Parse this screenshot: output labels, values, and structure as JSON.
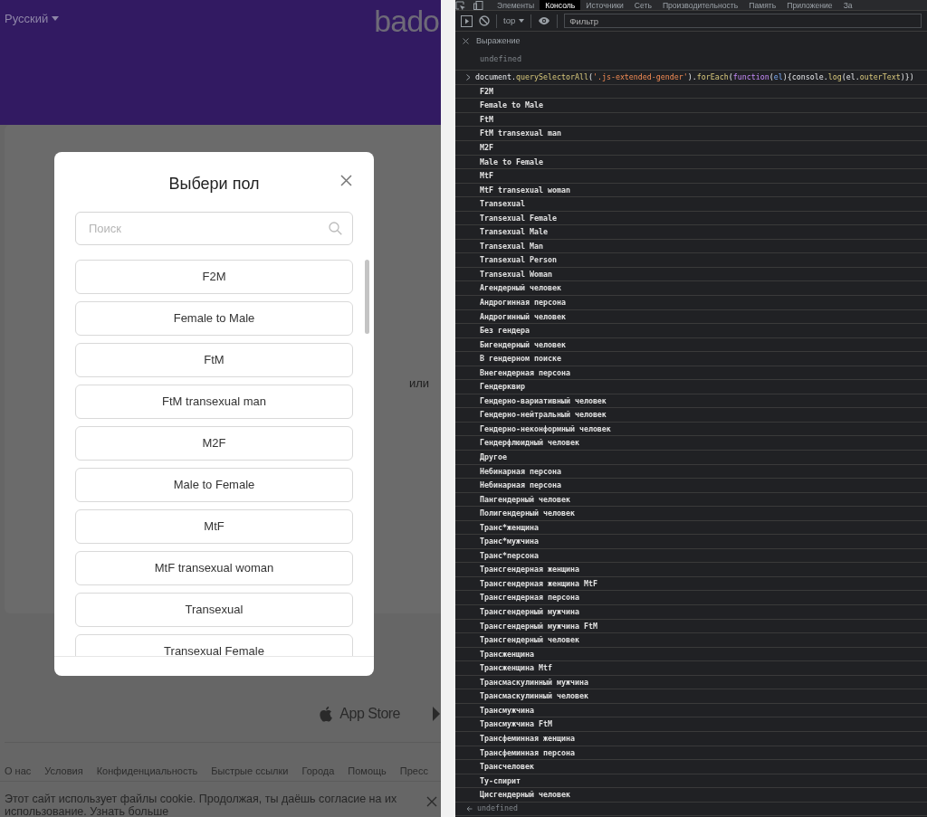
{
  "page": {
    "language": "Русский",
    "logo": "bado",
    "or_label": "или",
    "app_store": "App Store",
    "footer_links": [
      "О нас",
      "Условия",
      "Конфиденциальность",
      "Быстрые ссылки",
      "Города",
      "Помощь",
      "Пресс"
    ],
    "cookie": {
      "text": "Этот сайт использует файлы cookie. Продолжая, ты даёшь согласие на их использование.",
      "link": "Узнать больше"
    }
  },
  "modal": {
    "title": "Выбери пол",
    "search": {
      "placeholder": "Поиск"
    },
    "options": [
      "F2M",
      "Female to Male",
      "FtM",
      "FtM transexual man",
      "M2F",
      "Male to Female",
      "MtF",
      "MtF transexual woman",
      "Transexual",
      "Transexual Female"
    ]
  },
  "devtools": {
    "tabs": [
      {
        "label": "Элементы",
        "selected": false
      },
      {
        "label": "Консоль",
        "selected": true
      },
      {
        "label": "Источники",
        "selected": false
      },
      {
        "label": "Сеть",
        "selected": false
      },
      {
        "label": "Производительность",
        "selected": false
      },
      {
        "label": "Память",
        "selected": false
      },
      {
        "label": "Приложение",
        "selected": false
      },
      {
        "label": "За",
        "selected": false
      }
    ],
    "context": "top",
    "filter": {
      "placeholder": "Фильтр"
    },
    "live_expression": {
      "label": "Выражение",
      "value": "undefined"
    },
    "command": [
      {
        "kind": "plain",
        "text": "document."
      },
      {
        "kind": "method",
        "text": "querySelectorAll"
      },
      {
        "kind": "plain",
        "text": "("
      },
      {
        "kind": "string",
        "text": "'.js-extended-gender'"
      },
      {
        "kind": "plain",
        "text": ")."
      },
      {
        "kind": "method",
        "text": "forEach"
      },
      {
        "kind": "plain",
        "text": "("
      },
      {
        "kind": "keyword",
        "text": "function"
      },
      {
        "kind": "plain",
        "text": "("
      },
      {
        "kind": "param",
        "text": "el"
      },
      {
        "kind": "plain",
        "text": "){console."
      },
      {
        "kind": "method",
        "text": "log"
      },
      {
        "kind": "plain",
        "text": "(el."
      },
      {
        "kind": "method",
        "text": "outerText"
      },
      {
        "kind": "plain",
        "text": ")})"
      }
    ],
    "logs": [
      "F2M",
      "Female to Male",
      "FtM",
      "FtM transexual man",
      "M2F",
      "Male to Female",
      "MtF",
      "MtF transexual woman",
      "Transexual",
      "Transexual Female",
      "Transexual Male",
      "Transexual Man",
      "Transexual Person",
      "Transexual Woman",
      "Агендерный человек",
      "Андрогинная персона",
      "Андрогинный человек",
      "Без гендера",
      "Бигендерный человек",
      "В гендерном поиске",
      "Внегендерная персона",
      "Гендерквир",
      "Гендерно-вариативный человек",
      "Гендерно-нейтральный человек",
      "Гендерно-неконформный человек",
      "Гендерфлюидный человек",
      "Другое",
      "Небинарная персона",
      "Небинарная персона",
      "Пангендерный человек",
      "Полигендерный человек",
      "Транс*женщина",
      "Транс*мужчина",
      "Транс*персона",
      "Трансгендерная женщина",
      "Трансгендерная женщина MtF",
      "Трансгендерная персона",
      "Трансгендерный мужчина",
      "Трансгендерный мужчина FtM",
      "Трансгендерный человек",
      "Трансженщина",
      "Трансженщина Mtf",
      "Трансмаскулинный мужчина",
      "Трансмаскулинный человек",
      "Трансмужчина",
      "Трансмужчина FtM",
      "Трансфеминная женщина",
      "Трансфеминная персона",
      "Трансчеловек",
      "Ту-спирит",
      "Цисгендерный человек"
    ],
    "result": "undefined"
  }
}
